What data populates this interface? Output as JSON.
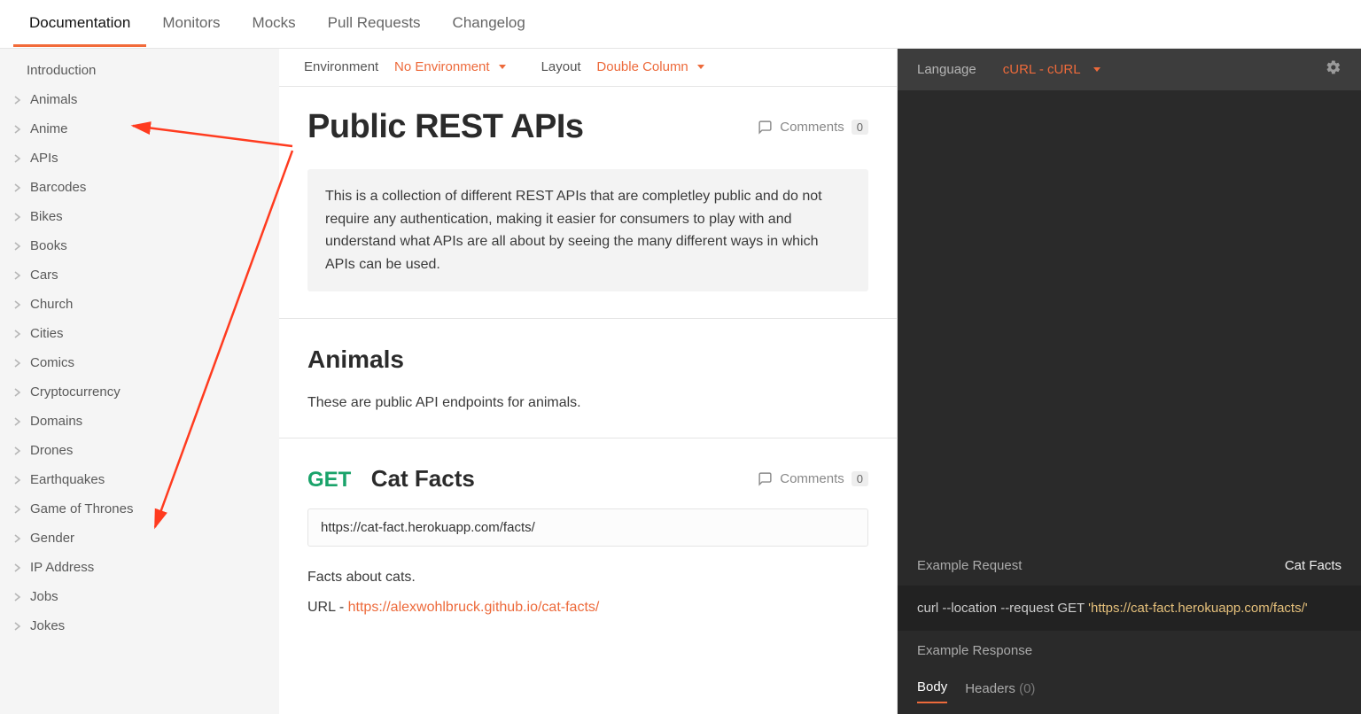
{
  "tabs": {
    "documentation": "Documentation",
    "monitors": "Monitors",
    "mocks": "Mocks",
    "pull_requests": "Pull Requests",
    "changelog": "Changelog"
  },
  "sidebar": {
    "intro": "Introduction",
    "items": [
      "Animals",
      "Anime",
      "APIs",
      "Barcodes",
      "Bikes",
      "Books",
      "Cars",
      "Church",
      "Cities",
      "Comics",
      "Cryptocurrency",
      "Domains",
      "Drones",
      "Earthquakes",
      "Game of Thrones",
      "Gender",
      "IP Address",
      "Jobs",
      "Jokes"
    ]
  },
  "toolbar": {
    "env_label": "Environment",
    "env_value": "No Environment",
    "layout_label": "Layout",
    "layout_value": "Double Column"
  },
  "page": {
    "title": "Public REST APIs",
    "comments_label": "Comments",
    "comments_count": "0",
    "intro_block": "This is a collection of different REST APIs that are completley public and do not require any authentication, making it easier for consumers to play with and understand what APIs are all about by seeing the many different ways in which APIs can be used."
  },
  "section": {
    "heading": "Animals",
    "desc": "These are public API endpoints for animals."
  },
  "endpoint": {
    "method": "GET",
    "title": "Cat Facts",
    "comments_label": "Comments",
    "comments_count": "0",
    "url": "https://cat-fact.herokuapp.com/facts/",
    "body_text1": "Facts about cats.",
    "body_text2_prefix": "URL - ",
    "body_link": "https://alexwohlbruck.github.io/cat-facts/"
  },
  "panel": {
    "language_label": "Language",
    "language_value": "cURL - cURL",
    "example_request_label": "Example Request",
    "example_name": "Cat Facts",
    "code_plain": "curl --location --request GET ",
    "code_url": "'https://cat-fact.herokuapp.com/facts/'",
    "example_response_label": "Example Response",
    "tab_body": "Body",
    "tab_headers": "Headers",
    "headers_count": "(0)"
  }
}
